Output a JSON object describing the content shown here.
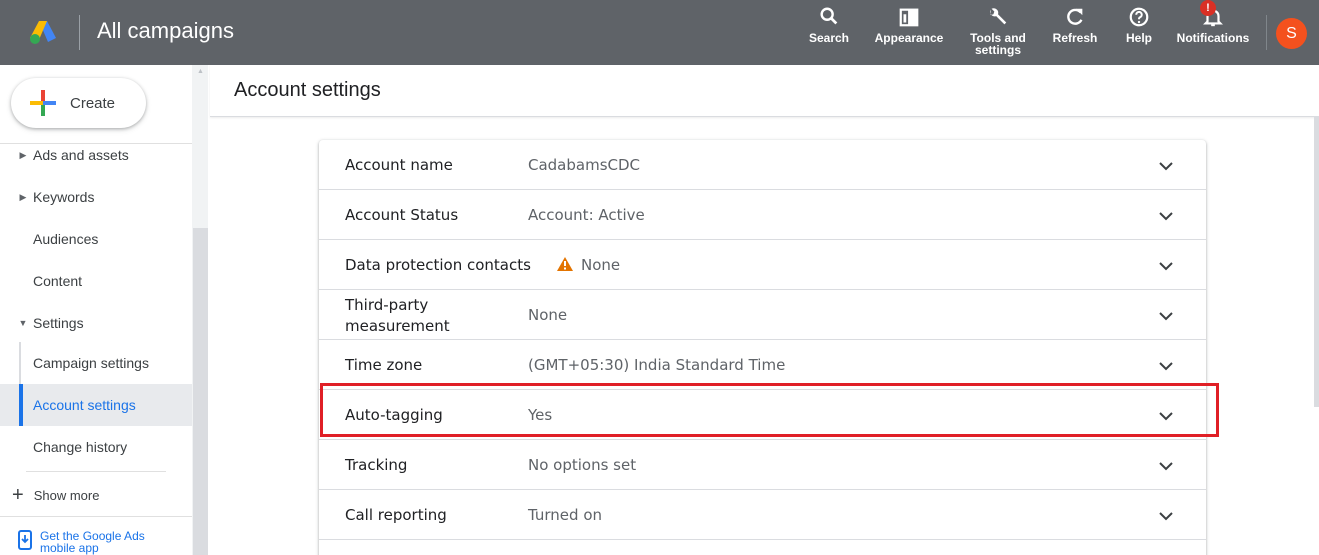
{
  "header": {
    "app_title": "All campaigns",
    "tools": [
      {
        "label": "Search",
        "icon": "search-icon"
      },
      {
        "label": "Appearance",
        "icon": "appearance-icon"
      },
      {
        "label": "Tools and settings",
        "icon": "wrench-icon"
      },
      {
        "label": "Refresh",
        "icon": "refresh-icon"
      },
      {
        "label": "Help",
        "icon": "help-icon"
      },
      {
        "label": "Notifications",
        "icon": "bell-icon",
        "badge": "!"
      }
    ],
    "avatar_initial": "S"
  },
  "sidebar": {
    "create_label": "Create",
    "items": [
      {
        "label": "Ads and assets"
      },
      {
        "label": "Keywords"
      },
      {
        "label": "Audiences"
      },
      {
        "label": "Content"
      },
      {
        "label": "Settings"
      },
      {
        "label": "Campaign settings"
      },
      {
        "label": "Account settings"
      },
      {
        "label": "Change history"
      }
    ],
    "show_more": "Show more",
    "mobile_app": "Get the Google Ads mobile app"
  },
  "main": {
    "title": "Account settings",
    "rows": [
      {
        "label": "Account name",
        "value": "CadabamsCDC"
      },
      {
        "label": "Account Status",
        "value": "Account: Active"
      },
      {
        "label": "Data protection contacts",
        "value": "None",
        "warning": true
      },
      {
        "label": "Third-party measurement",
        "value": "None"
      },
      {
        "label": "Time zone",
        "value": "(GMT+05:30) India Standard Time"
      },
      {
        "label": "Auto-tagging",
        "value": "Yes",
        "highlighted": true
      },
      {
        "label": "Tracking",
        "value": "No options set"
      },
      {
        "label": "Call reporting",
        "value": "Turned on"
      }
    ]
  },
  "colors": {
    "topbar": "#5f6368",
    "accent": "#1a73e8",
    "highlight": "#e01f26",
    "warning": "#e37400",
    "avatar": "#f4511e"
  }
}
